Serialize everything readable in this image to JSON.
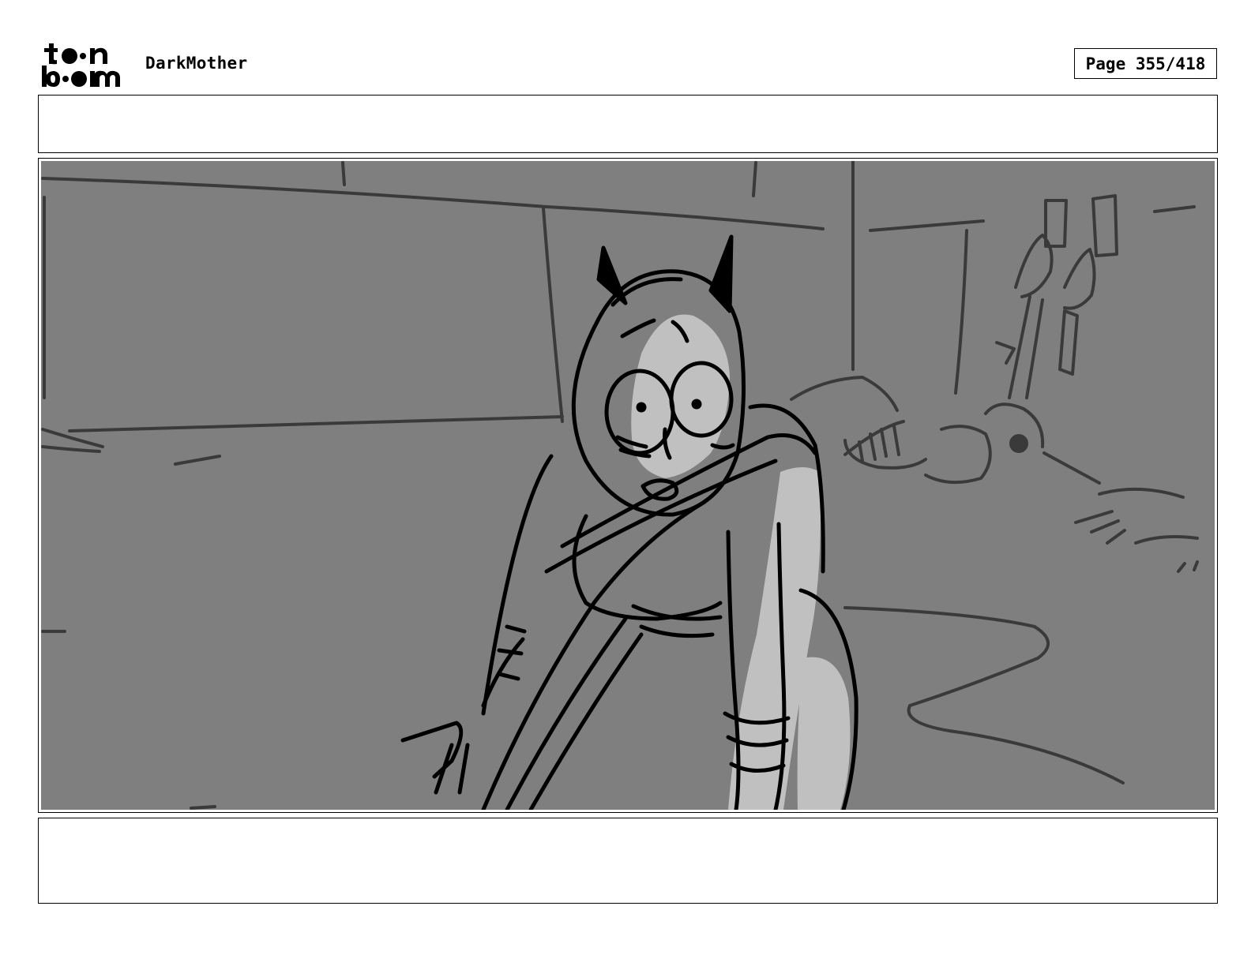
{
  "header": {
    "logo_text": "toon boom",
    "project_title": "DarkMother",
    "page_label": "Page 355/418"
  },
  "panel": {
    "background_color": "#7f7f7f",
    "highlight_color": "#c0c0c0",
    "line_color": "#000000"
  },
  "notes": {
    "top": "",
    "bottom": ""
  }
}
